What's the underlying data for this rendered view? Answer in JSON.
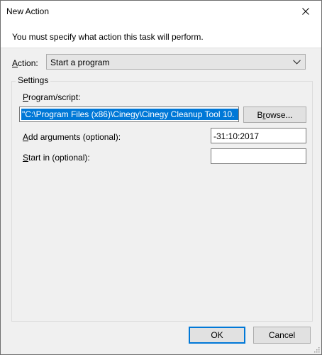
{
  "window": {
    "title": "New Action"
  },
  "instruction": "You must specify what action this task will perform.",
  "action": {
    "label_key": "A",
    "label_rest": "ction:",
    "selected": "Start a program"
  },
  "settings": {
    "legend": "Settings",
    "program": {
      "label_key": "P",
      "label_rest": "rogram/script:",
      "value": "\"C:\\Program Files (x86)\\Cinegy\\Cinegy Cleanup Tool  10.",
      "browse_prefix": "B",
      "browse_key": "r",
      "browse_rest": "owse..."
    },
    "arguments": {
      "label_key": "A",
      "label_rest": "dd arguments (optional):",
      "value": "-31:10:2017"
    },
    "start_in": {
      "label_key": "S",
      "label_rest": "tart in (optional):",
      "value": ""
    }
  },
  "buttons": {
    "ok": "OK",
    "cancel": "Cancel"
  },
  "icons": {
    "close": "close-icon",
    "dropdown": "chevron-down-icon",
    "resize": "resize-grip-icon"
  },
  "colors": {
    "selection": "#0078d7",
    "focus_border": "#0078d7"
  }
}
